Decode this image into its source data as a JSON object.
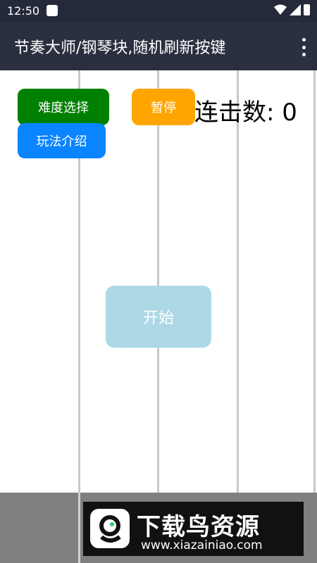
{
  "status_bar": {
    "time": "12:50"
  },
  "app_bar": {
    "title": "节奏大师/钢琴块,随机刷新按键"
  },
  "controls": {
    "difficulty_label": "难度选择",
    "howto_label": "玩法介绍",
    "pause_label": "暂停",
    "combo_text": "连击数: 0",
    "start_label": "开始"
  },
  "watermark": {
    "title": "下载鸟资源",
    "url": "www.xiazainiao.com"
  },
  "colors": {
    "difficulty_button": "#008000",
    "howto_button": "#0a84ff",
    "pause_button": "#ffa500",
    "start_button": "#add8e6",
    "bottom_bar": "#808080"
  }
}
